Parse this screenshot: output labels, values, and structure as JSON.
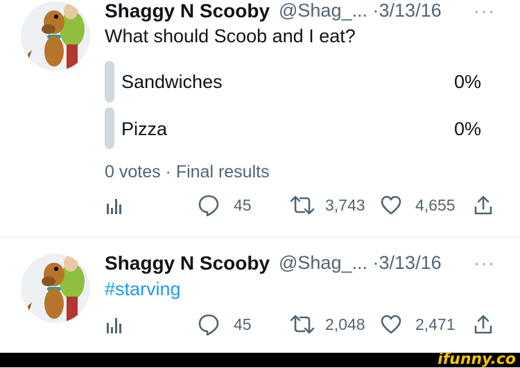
{
  "tweets": [
    {
      "display_name": "Shaggy N Scooby",
      "handle": "@Shag_...",
      "date_sep": "·",
      "date": "3/13/16",
      "more": "···",
      "text": "What should Scoob and I eat?",
      "poll": {
        "options": [
          {
            "label": "Sandwiches",
            "percent": "0%",
            "fill": 0
          },
          {
            "label": "Pizza",
            "percent": "0%",
            "fill": 0
          }
        ],
        "summary": "0 votes · Final results"
      },
      "actions": {
        "analytics_icon": "analytics-icon",
        "replies": "45",
        "retweets": "3,743",
        "likes": "4,655",
        "share_icon": "share-icon"
      }
    },
    {
      "display_name": "Shaggy N Scooby",
      "handle": "@Shag_...",
      "date_sep": "·",
      "date": "3/13/16",
      "more": "···",
      "hashtag": "#starving",
      "actions": {
        "analytics_icon": "analytics-icon",
        "replies": "45",
        "retweets": "2,048",
        "likes": "2,471",
        "share_icon": "share-icon"
      }
    }
  ],
  "watermark": "ifunny.co",
  "colors": {
    "link": "#1d9bf0",
    "muted": "#536471",
    "poll_bar": "#cfd9de",
    "footer": "#000000",
    "watermark": "#f5c400"
  }
}
